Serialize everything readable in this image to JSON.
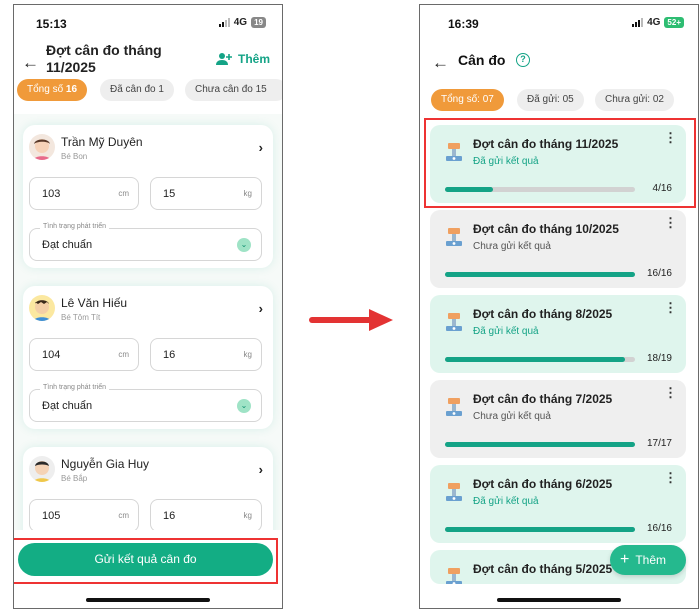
{
  "left_screen": {
    "status": {
      "time": "15:13",
      "network": "4G",
      "battery": "19"
    },
    "title": "Đợt cân đo tháng 11/2025",
    "add_label": "Thêm",
    "filters": [
      {
        "label": "Tổng số",
        "count": "16"
      },
      {
        "label": "Đã cân đo 1"
      },
      {
        "label": "Chưa cân đo 15"
      }
    ],
    "children": [
      {
        "name": "Trần Mỹ Duyên",
        "nickname": "Bé Bon",
        "height": "103",
        "height_unit": "cm",
        "weight": "15",
        "weight_unit": "kg",
        "dev_label": "Tình trạng phát triển",
        "dev_value": "Đạt chuẩn"
      },
      {
        "name": "Lê Văn Hiếu",
        "nickname": "Bé Tôm Tít",
        "height": "104",
        "height_unit": "cm",
        "weight": "16",
        "weight_unit": "kg",
        "dev_label": "Tình trạng phát triển",
        "dev_value": "Đạt chuẩn"
      },
      {
        "name": "Nguyễn Gia Huy",
        "nickname": "Bé Bắp",
        "height": "105",
        "height_unit": "cm",
        "weight": "16",
        "weight_unit": "kg"
      }
    ],
    "submit_label": "Gửi kết quả cân đo"
  },
  "right_screen": {
    "status": {
      "time": "16:39",
      "network": "4G",
      "battery": "52+"
    },
    "title": "Cân đo",
    "help_icon": "?",
    "filters": [
      {
        "label": "Tổng số: 07"
      },
      {
        "label": "Đã gửi: 05"
      },
      {
        "label": "Chưa gửi: 02"
      }
    ],
    "records": [
      {
        "title": "Đợt cân đo tháng 11/2025",
        "status": "Đã gửi kết quả",
        "state": "sent",
        "done": 4,
        "total": 16,
        "count": "4/16"
      },
      {
        "title": "Đợt cân đo tháng 10/2025",
        "status": "Chưa gửi kết quả",
        "state": "pending",
        "done": 16,
        "total": 16,
        "count": "16/16"
      },
      {
        "title": "Đợt cân đo tháng 8/2025",
        "status": "Đã gửi kết quả",
        "state": "sent",
        "done": 18,
        "total": 19,
        "count": "18/19"
      },
      {
        "title": "Đợt cân đo tháng 7/2025",
        "status": "Chưa gửi kết quả",
        "state": "pending",
        "done": 17,
        "total": 17,
        "count": "17/17"
      },
      {
        "title": "Đợt cân đo tháng 6/2025",
        "status": "Đã gửi kết quả",
        "state": "sent",
        "done": 16,
        "total": 16,
        "count": "16/16"
      },
      {
        "title": "Đợt cân đo tháng 5/2025",
        "status": "",
        "state": "sent"
      }
    ],
    "fab_label": "Thêm"
  },
  "colors": {
    "accent": "#14a386",
    "orange": "#f09a3a",
    "highlight_red": "#e33333"
  },
  "icons": [
    "back-arrow-icon",
    "add-user-icon",
    "chevron-right-icon",
    "chevron-down-icon",
    "scale-icon",
    "more-vertical-icon",
    "help-icon",
    "plus-icon",
    "right-arrow-icon"
  ]
}
